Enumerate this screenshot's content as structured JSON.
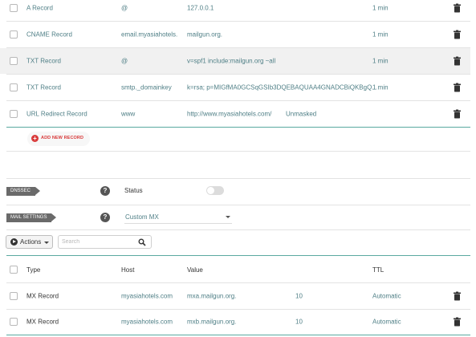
{
  "records_top": [
    {
      "type": "A Record",
      "host": "@",
      "value": "127.0.0.1",
      "extra": "",
      "ttl": "1 min"
    },
    {
      "type": "CNAME Record",
      "host": "email.myasiahotels.",
      "value": "mailgun.org.",
      "extra": "",
      "ttl": "1 min"
    },
    {
      "type": "TXT Record",
      "host": "@",
      "value": "v=spf1 include:mailgun.org ~all",
      "extra": "",
      "ttl": "1 min"
    },
    {
      "type": "TXT Record",
      "host": "smtp._domainkey",
      "value": "k=rsa; p=MIGfMA0GCSqGSIb3DQEBAQUAA4GNADCBiQKBgQ...",
      "extra": "",
      "ttl": "1 min"
    },
    {
      "type": "URL Redirect Record",
      "host": "www",
      "value": "http://www.myasiahotels.com/",
      "extra": "Unmasked",
      "ttl": ""
    }
  ],
  "add_new_record_label": "ADD NEW RECORD",
  "dnssec": {
    "tag": "DNSSEC",
    "help": "?",
    "status_label": "Status",
    "enabled": false
  },
  "mail": {
    "tag": "MAIL SETTINGS",
    "help": "?",
    "selected": "Custom MX"
  },
  "toolbar": {
    "actions_label": "Actions",
    "search_placeholder": "Search"
  },
  "mx_table": {
    "headers": {
      "type": "Type",
      "host": "Host",
      "value": "Value",
      "ttl": "TTL"
    },
    "rows": [
      {
        "type": "MX Record",
        "host": "myasiahotels.com",
        "value": "mxa.mailgun.org.",
        "priority": "10",
        "ttl": "Automatic"
      },
      {
        "type": "MX Record",
        "host": "myasiahotels.com",
        "value": "mxb.mailgun.org.",
        "priority": "10",
        "ttl": "Automatic"
      }
    ]
  },
  "colors": {
    "accent": "#5aa9a0",
    "add": "#d93b3b",
    "text_teal": "#4f7f86",
    "highlight_row": "#f1f1f1"
  },
  "icons": {
    "delete": "trash-icon",
    "add": "plus-icon",
    "help": "question-icon",
    "search": "magnifier-icon",
    "actions": "play-icon"
  }
}
